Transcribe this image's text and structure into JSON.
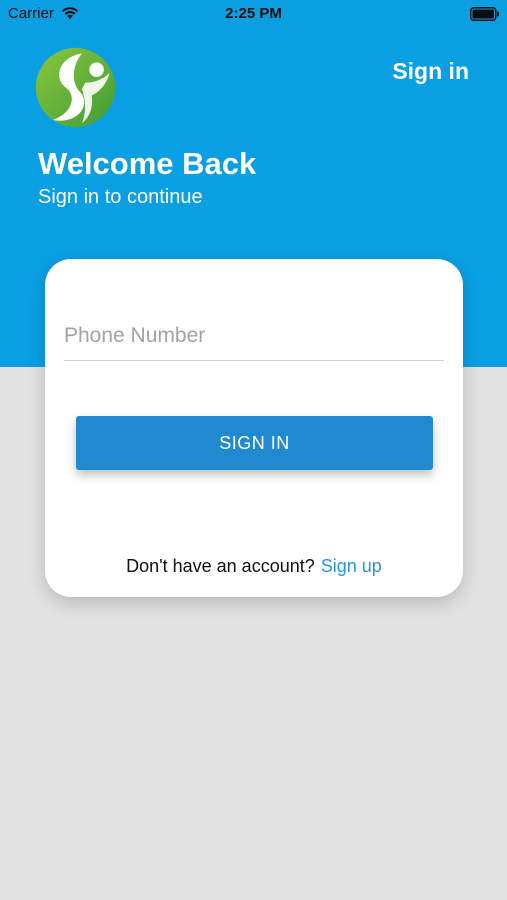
{
  "status_bar": {
    "carrier": "Carrier",
    "time": "2:25 PM"
  },
  "header": {
    "nav_sign_in": "Sign in",
    "title": "Welcome Back",
    "subtitle": "Sign in to continue",
    "background_color": "#0a9fe3"
  },
  "form": {
    "phone_placeholder": "Phone Number",
    "phone_value": "",
    "sign_in_button": "SIGN IN",
    "button_color": "#2089d0"
  },
  "footer": {
    "prompt": "Don't have an account?",
    "sign_up_link": "Sign up",
    "link_color": "#2a95dc"
  },
  "icons": {
    "logo": "green-person-logo-icon",
    "wifi": "wifi-icon",
    "battery": "battery-icon"
  }
}
